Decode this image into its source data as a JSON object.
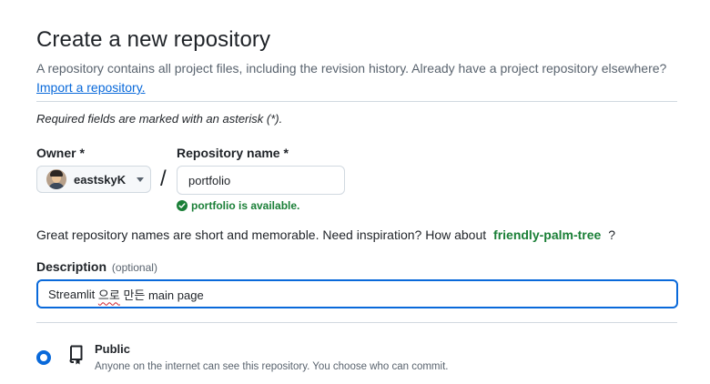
{
  "header": {
    "title": "Create a new repository",
    "description": "A repository contains all project files, including the revision history. Already have a project repository elsewhere?",
    "import_link": "Import a repository."
  },
  "form": {
    "required_note": "Required fields are marked with an asterisk (*).",
    "owner": {
      "label": "Owner *",
      "value": "eastskyK",
      "avatar_icon": "user-avatar"
    },
    "separator": "/",
    "repository_name": {
      "label": "Repository name *",
      "value": "portfolio",
      "availability": "portfolio is available.",
      "availability_icon": "check-circle-icon"
    },
    "suggestion": {
      "prefix": "Great repository names are short and memorable. Need inspiration? How about",
      "name": "friendly-palm-tree",
      "suffix": "?"
    },
    "description": {
      "label": "Description",
      "optional": "(optional)",
      "value_part1": "Streamlit ",
      "value_misspelled": "으로",
      "value_part2": " 만든 main page"
    },
    "visibility": {
      "selected": "Public",
      "options": [
        {
          "label": "Public",
          "description": "Anyone on the internet can see this repository. You choose who can commit.",
          "icon": "repo-icon"
        }
      ]
    }
  },
  "colors": {
    "accent": "#0969da",
    "success": "#1a7f37",
    "muted": "#59636e",
    "border": "#d1d9e0"
  }
}
